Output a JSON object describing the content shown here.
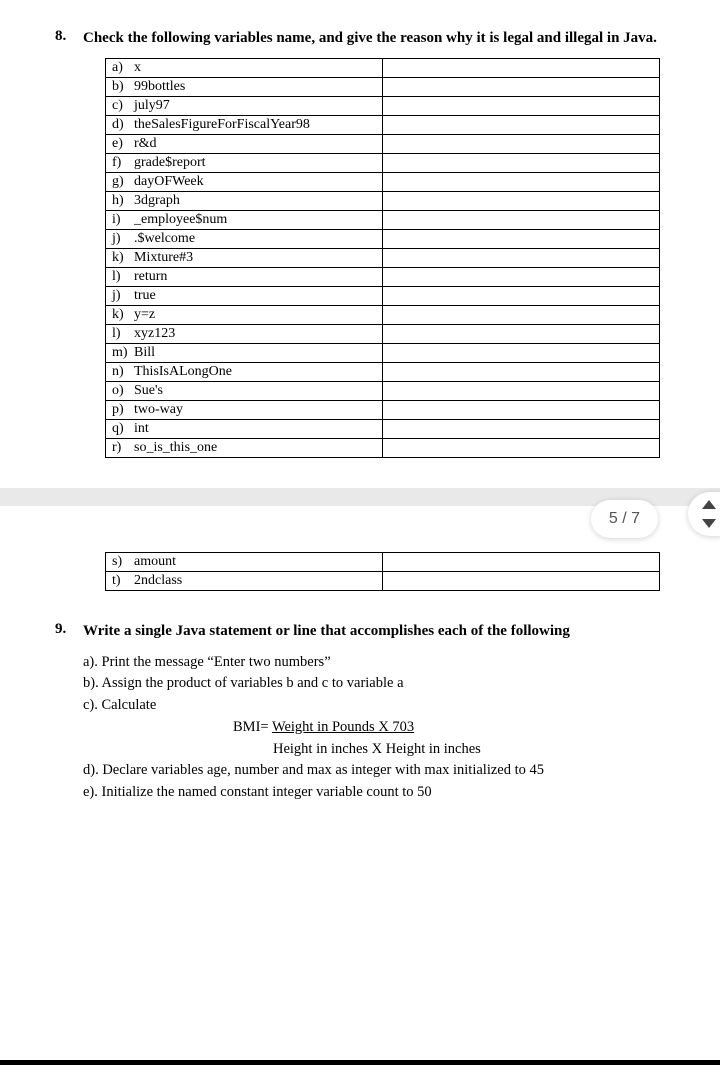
{
  "q8": {
    "number": "8.",
    "text": "Check the following variables name, and give the reason why it is legal and illegal in Java.",
    "rows": [
      {
        "letter": "a)",
        "var": "x"
      },
      {
        "letter": "b)",
        "var": "99bottles"
      },
      {
        "letter": "c)",
        "var": "july97"
      },
      {
        "letter": "d)",
        "var": "theSalesFigureForFiscalYear98"
      },
      {
        "letter": "e)",
        "var": "r&d"
      },
      {
        "letter": "f)",
        "var": "grade$report"
      },
      {
        "letter": "g)",
        "var": "dayOFWeek"
      },
      {
        "letter": "h)",
        "var": "3dgraph"
      },
      {
        "letter": "i)",
        "var": "_employee$num"
      },
      {
        "letter": "j)",
        "var": ".$welcome"
      },
      {
        "letter": "k)",
        "var": "Mixture#3"
      },
      {
        "letter": "l)",
        "var": "return"
      },
      {
        "letter": "j)",
        "var": "true"
      },
      {
        "letter": "k)",
        "var": "y=z"
      },
      {
        "letter": "l)",
        "var": "xyz123"
      },
      {
        "letter": "m)",
        "var": "Bill"
      },
      {
        "letter": "n)",
        "var": "ThisIsALongOne"
      },
      {
        "letter": "o)",
        "var": "Sue's"
      },
      {
        "letter": "p)",
        "var": "two-way"
      },
      {
        "letter": "q)",
        "var": "int"
      },
      {
        "letter": "r)",
        "var": "so_is_this_one"
      }
    ],
    "rows2": [
      {
        "letter": "s)",
        "var": "amount"
      },
      {
        "letter": "t)",
        "var": "2ndclass"
      }
    ]
  },
  "pager": {
    "label": "5 / 7"
  },
  "q9": {
    "number": "9.",
    "text": "Write a single Java statement or line that accomplishes each of the following",
    "items": {
      "a": "a). Print the message “Enter two numbers”",
      "b": "b). Assign the product of variables b and c to variable a",
      "c": "c). Calculate",
      "bmi1_lhs": "BMI=  ",
      "bmi1_rhs": "Weight in Pounds X  703",
      "bmi2": "Height in inches X Height in inches",
      "d": "d). Declare variables age, number and max as integer with max initialized to 45",
      "e": "e). Initialize the named constant integer variable count to 50"
    }
  }
}
